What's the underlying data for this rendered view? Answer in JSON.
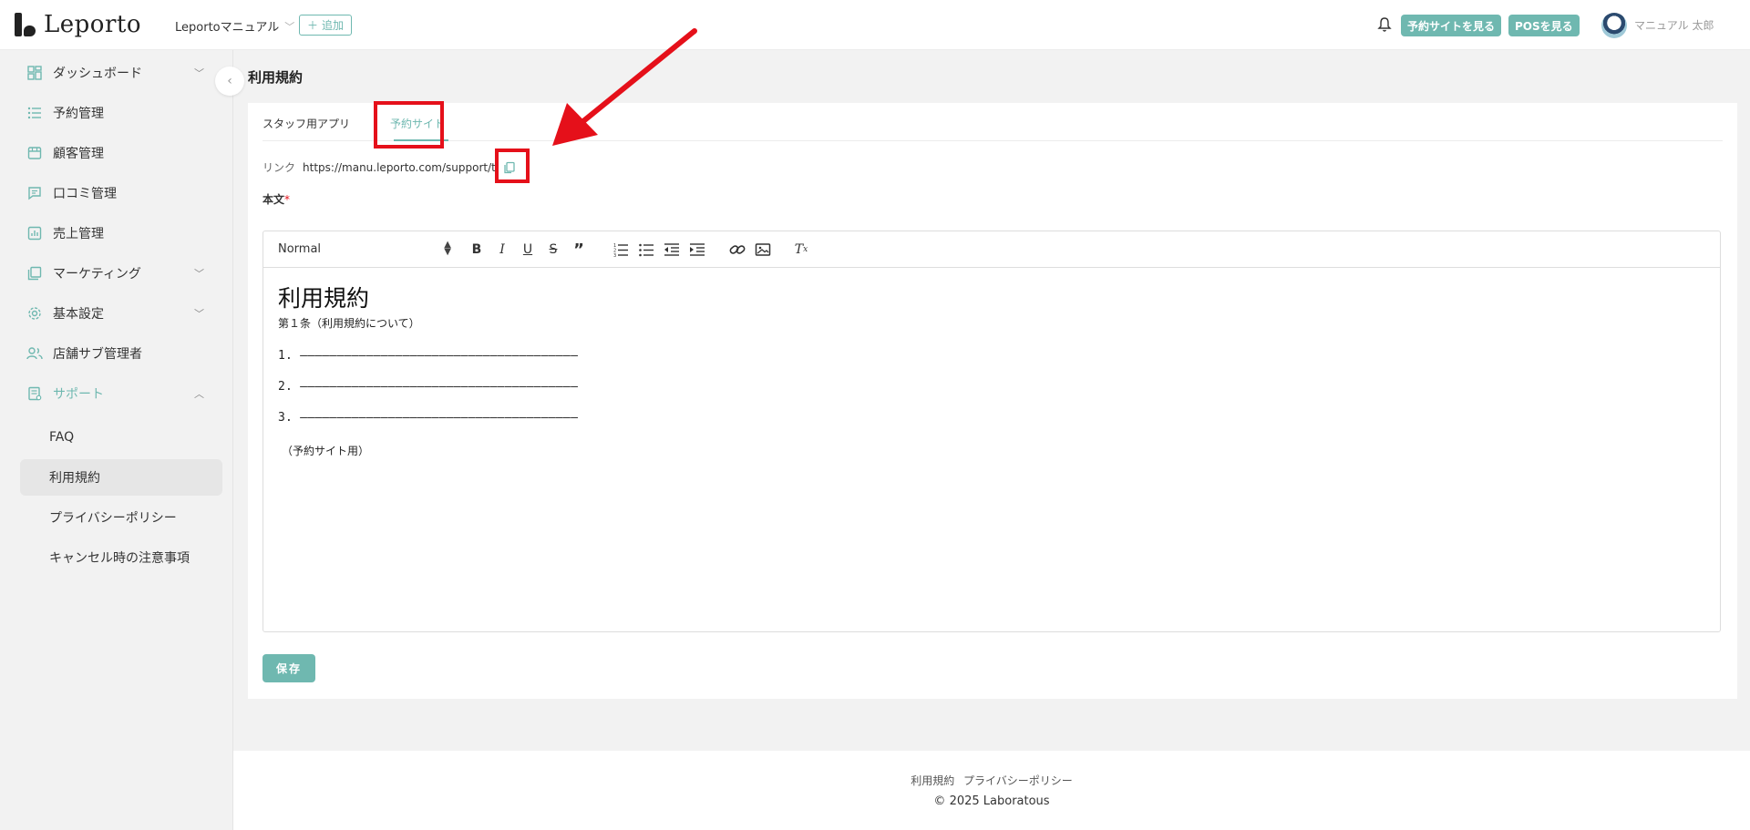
{
  "header": {
    "logo_text": "Leporto",
    "store_name": "Leportoマニュアル",
    "add_label": "追加",
    "view_booking_site": "予約サイトを見る",
    "view_pos": "POSを見る",
    "user_name": "マニュアル 太郎"
  },
  "sidebar": {
    "items": [
      {
        "label": "ダッシュボード"
      },
      {
        "label": "予約管理"
      },
      {
        "label": "顧客管理"
      },
      {
        "label": "口コミ管理"
      },
      {
        "label": "売上管理"
      },
      {
        "label": "マーケティング"
      },
      {
        "label": "基本設定"
      },
      {
        "label": "店舗サブ管理者"
      },
      {
        "label": "サポート"
      }
    ],
    "support_children": [
      {
        "label": "FAQ"
      },
      {
        "label": "利用規約"
      },
      {
        "label": "プライバシーポリシー"
      },
      {
        "label": "キャンセル時の注意事項"
      }
    ]
  },
  "page": {
    "title": "利用規約",
    "tabs": [
      {
        "label": "スタッフ用アプリ"
      },
      {
        "label": "予約サイト"
      }
    ],
    "link_label": "リンク",
    "link_url": "https://manu.leporto.com/support/terms",
    "body_label": "本文",
    "required_mark": "*",
    "save_label": "保存"
  },
  "editor": {
    "format_value": "Normal",
    "heading": "利用規約",
    "article": "第１条（利用規約について）",
    "lines": [
      "1. ――――――――――――――――――――――――――――――――――――――",
      "2. ――――――――――――――――――――――――――――――――――――――",
      "3. ――――――――――――――――――――――――――――――――――――――"
    ],
    "note": "（予約サイト用）"
  },
  "footer": {
    "links": [
      "利用規約",
      "プライバシーポリシー"
    ],
    "copyright": "2025 Laboratous"
  },
  "colors": {
    "accent": "#6fb8b0",
    "annotation": "#e5101a"
  }
}
